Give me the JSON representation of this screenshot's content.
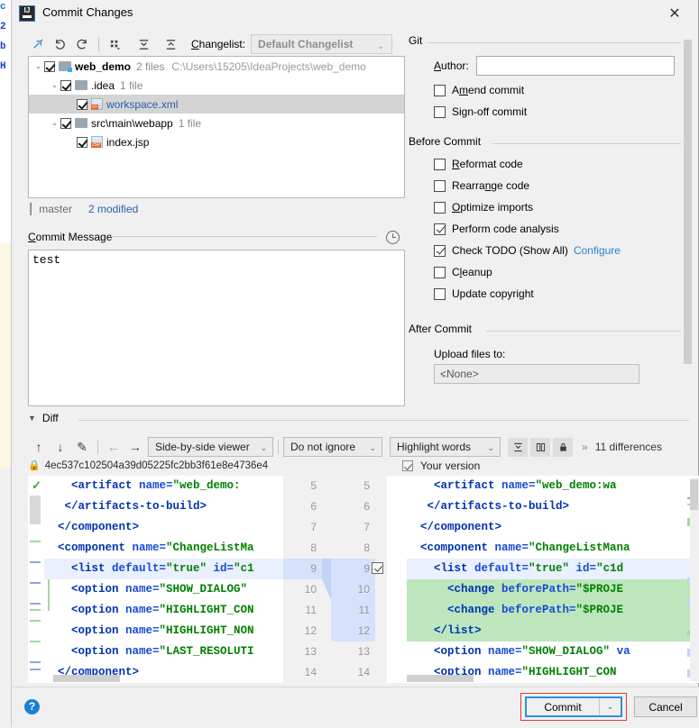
{
  "window": {
    "title": "Commit Changes",
    "app_icon": "intellij-idea-icon",
    "close_label": "✕"
  },
  "toolbar": {
    "icons": [
      "refresh-changes-icon",
      "revert-icon",
      "rollback-icon",
      "group-by-icon",
      "expand-all-icon",
      "collapse-all-icon"
    ],
    "changelist_label": "Changelist:",
    "changelist_value": "Default Changelist",
    "chevron": "⌄"
  },
  "tree": {
    "rows": [
      {
        "indent": 0,
        "arrow": "⌄",
        "checked": true,
        "icon": "folder-modified-icon",
        "name": "web_demo",
        "meta": "2 files",
        "path": "C:\\Users\\15205\\IdeaProjects\\web_demo",
        "selected": false,
        "link": false
      },
      {
        "indent": 1,
        "arrow": "⌄",
        "checked": true,
        "icon": "folder-icon",
        "name": ".idea",
        "meta": "1 file",
        "path": "",
        "selected": false,
        "link": false
      },
      {
        "indent": 2,
        "arrow": "",
        "checked": true,
        "icon": "xml-file-icon",
        "tag": "<>",
        "name": "workspace.xml",
        "meta": "",
        "path": "",
        "selected": true,
        "link": true
      },
      {
        "indent": 1,
        "arrow": "⌄",
        "checked": true,
        "icon": "folder-icon",
        "name": "src\\main\\webapp",
        "meta": "1 file",
        "path": "",
        "selected": false,
        "link": false
      },
      {
        "indent": 2,
        "arrow": "",
        "checked": true,
        "icon": "jsp-file-icon",
        "tag": "JSP",
        "name": "index.jsp",
        "meta": "",
        "path": "",
        "selected": false,
        "link": false
      }
    ]
  },
  "branch_bar": {
    "icon": "git-branch-icon",
    "branch": "master",
    "modified": "2 modified"
  },
  "commit_message": {
    "section_title": "Commit Message",
    "history_icon": "clock-history-icon",
    "value": "test"
  },
  "options": {
    "git_section": "Git",
    "author_label": "Author:",
    "author_value": "",
    "git_checkboxes": [
      {
        "label": "Amend commit",
        "checked": false,
        "name": "amend-commit"
      },
      {
        "label": "Sign-off commit",
        "checked": false,
        "name": "sign-off-commit"
      }
    ],
    "before_commit_section": "Before Commit",
    "before_commit": [
      {
        "label": "Reformat code",
        "checked": false,
        "name": "reformat-code"
      },
      {
        "label": "Rearrange code",
        "checked": false,
        "name": "rearrange-code"
      },
      {
        "label": "Optimize imports",
        "checked": false,
        "name": "optimize-imports"
      },
      {
        "label": "Perform code analysis",
        "checked": true,
        "name": "perform-code-analysis"
      },
      {
        "label": "Check TODO (Show All)",
        "checked": true,
        "name": "check-todo",
        "link": "Configure"
      },
      {
        "label": "Cleanup",
        "checked": false,
        "name": "cleanup"
      },
      {
        "label": "Update copyright",
        "checked": false,
        "name": "update-copyright"
      }
    ],
    "after_commit_section": "After Commit",
    "upload_label": "Upload files to:",
    "upload_value": "<None>"
  },
  "diff": {
    "section_title": "Diff",
    "caret": "▼",
    "nav_icons": [
      "previous-difference-icon",
      "next-difference-icon",
      "edit-source-icon",
      "arrow-left-icon",
      "arrow-right-icon"
    ],
    "viewer_mode": "Side-by-side viewer",
    "ignore_mode": "Do not ignore",
    "highlight_mode": "Highlight words",
    "toggle_icons": [
      "collapse-unchanged-icon",
      "synchronize-scroll-icon",
      "read-only-lock-icon"
    ],
    "more_chevron": "»",
    "differences_count": "11 differences",
    "left_lock_icon": "lock-icon",
    "left_revision": "4ec537c102504a39d05225fc2bb3f61e8e4736e4",
    "right_label": "Your version",
    "left_lines": [
      {
        "num": "5",
        "text": "    <artifact name=\"web_demo:",
        "state": "plain"
      },
      {
        "num": "6",
        "text": "   </artifacts-to-build>",
        "state": "plain"
      },
      {
        "num": "7",
        "text": "  </component>",
        "state": "plain"
      },
      {
        "num": "8",
        "text": "  <component name=\"ChangeListMa",
        "state": "plain"
      },
      {
        "num": "9",
        "text": "    <list default=\"true\" id=\"c1",
        "state": "selected"
      },
      {
        "num": "10",
        "text": "    <option name=\"SHOW_DIALOG\"",
        "state": "plain"
      },
      {
        "num": "11",
        "text": "    <option name=\"HIGHLIGHT_CON",
        "state": "plain"
      },
      {
        "num": "12",
        "text": "    <option name=\"HIGHLIGHT_NON",
        "state": "plain"
      },
      {
        "num": "13",
        "text": "    <option name=\"LAST_RESOLUTI",
        "state": "plain"
      },
      {
        "num": "14",
        "text": "  </component>",
        "state": "plain"
      }
    ],
    "right_lines": [
      {
        "num": "5",
        "text": "    <artifact name=\"web_demo:wa",
        "state": "plain"
      },
      {
        "num": "6",
        "text": "   </artifacts-to-build>",
        "state": "plain"
      },
      {
        "num": "7",
        "text": "  </component>",
        "state": "plain"
      },
      {
        "num": "8",
        "text": "  <component name=\"ChangeListMana",
        "state": "plain"
      },
      {
        "num": "9",
        "text": "    <list default=\"true\" id=\"c1d",
        "state": "selected"
      },
      {
        "num": "10",
        "text": "      <change beforePath=\"$PROJE",
        "state": "added"
      },
      {
        "num": "11",
        "text": "      <change beforePath=\"$PROJE",
        "state": "added"
      },
      {
        "num": "12",
        "text": "    </list>",
        "state": "added"
      },
      {
        "num": "13",
        "text": "    <option name=\"SHOW_DIALOG\" va",
        "state": "plain"
      },
      {
        "num": "14",
        "text": "    <option name=\"HIGHLIGHT_CON",
        "state": "plain"
      }
    ]
  },
  "footer": {
    "help_label": "?",
    "commit_label": "Commit",
    "commit_chevron": "⌄",
    "cancel_label": "Cancel",
    "highlight_color": "#e23b2e",
    "focus_color": "#2f8fd8"
  },
  "background": {
    "fragments": [
      "c",
      "2",
      "b",
      "H"
    ]
  }
}
